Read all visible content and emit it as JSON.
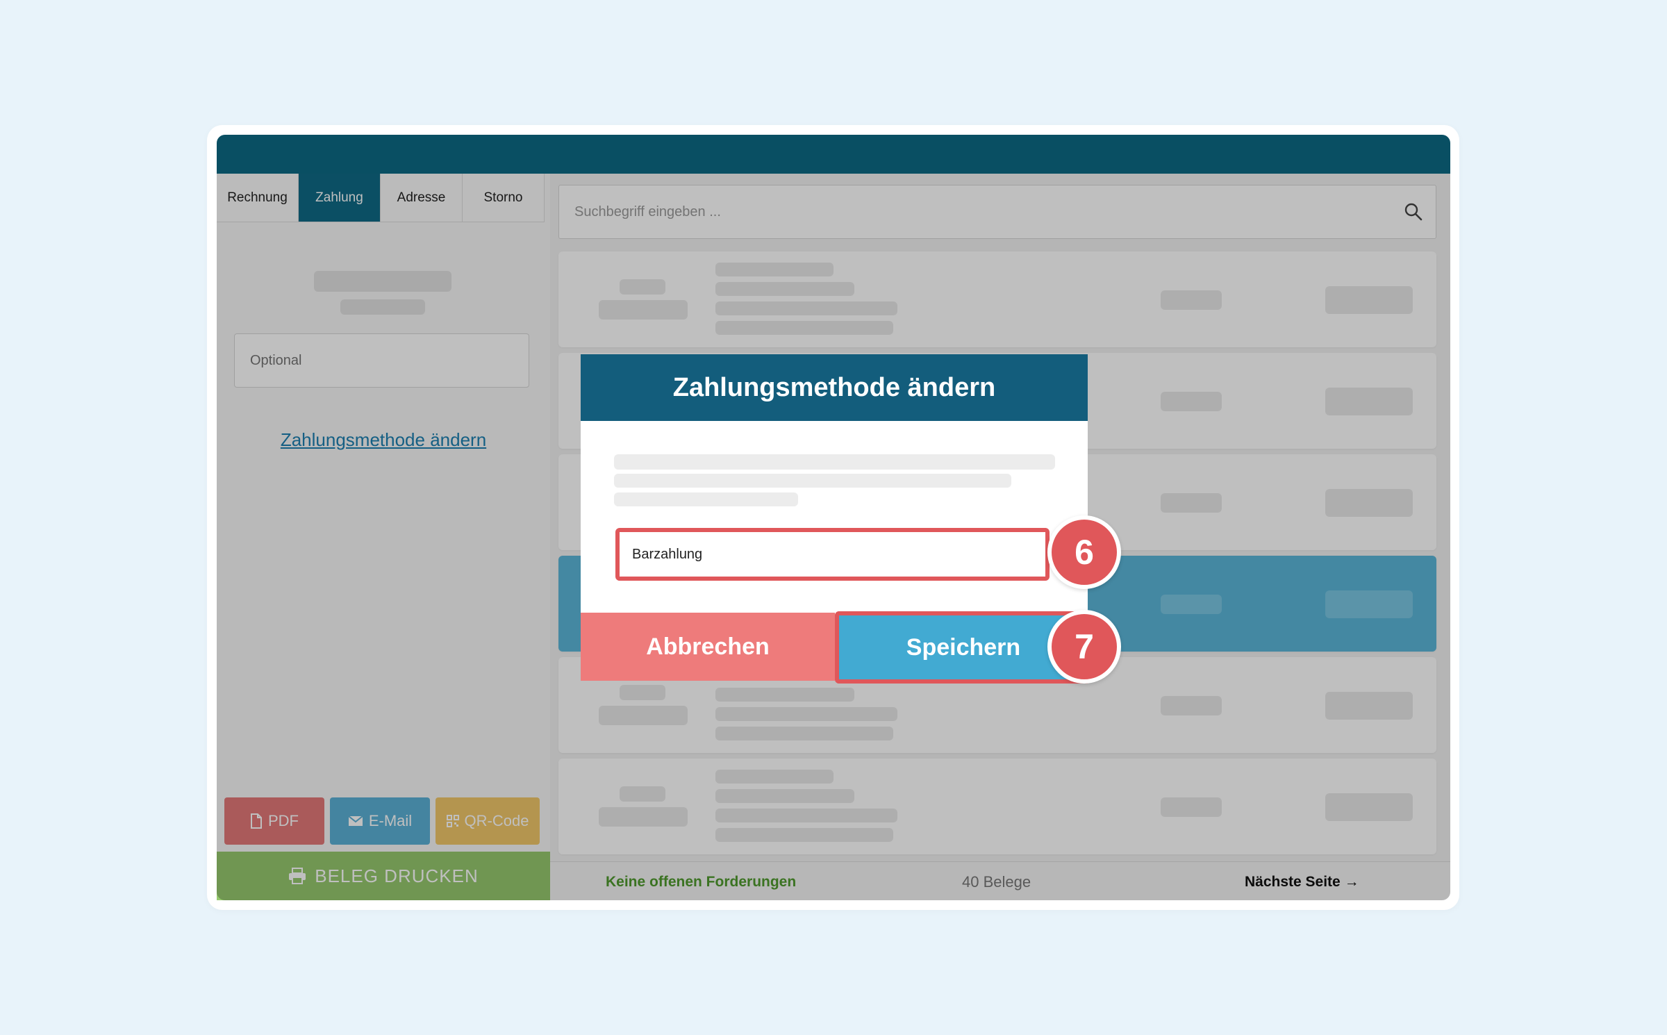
{
  "left_panel": {
    "tabs": [
      {
        "label": "Rechnung",
        "active": false
      },
      {
        "label": "Zahlung",
        "active": true
      },
      {
        "label": "Adresse",
        "active": false
      },
      {
        "label": "Storno",
        "active": false
      }
    ],
    "optional_placeholder": "Optional",
    "change_method_link": "Zahlungsmethode ändern",
    "actions": {
      "pdf": "PDF",
      "email": "E-Mail",
      "qr": "QR-Code"
    },
    "print_button": "BELEG DRUCKEN"
  },
  "right_panel": {
    "search_placeholder": "Suchbegriff eingeben ...",
    "footer": {
      "open_claims": "Keine offenen Forderungen",
      "count": "40 Belege",
      "next_page": "Nächste Seite"
    }
  },
  "modal": {
    "title": "Zahlungsmethode ändern",
    "selected_method": "Barzahlung",
    "cancel_label": "Abbrechen",
    "save_label": "Speichern"
  },
  "callouts": {
    "step_select": "6",
    "step_save": "7"
  },
  "colors": {
    "brand": "#0f6a86",
    "accent_red": "#e0575a",
    "save_blue": "#42aad2",
    "print_green": "#96c96e",
    "pdf": "#e37879",
    "email": "#5bb0d6",
    "qr": "#f1c76a"
  }
}
